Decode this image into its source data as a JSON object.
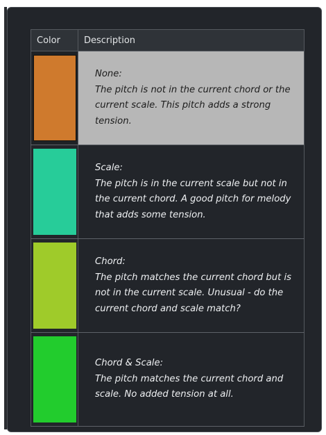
{
  "table": {
    "headers": {
      "color": "Color",
      "description": "Description"
    },
    "rows": [
      {
        "title": "None:",
        "text": "The pitch is not in the current chord or the current scale. This pitch adds a strong tension.",
        "color": "#cf7a2d",
        "selected": true
      },
      {
        "title": "Scale:",
        "text": "The pitch is in the current scale but not in the current chord. A good pitch for melody that adds some tension.",
        "color": "#27cc99",
        "selected": false
      },
      {
        "title": "Chord:",
        "text": "The pitch matches the current chord but is not in the current scale. Unusual - do the current chord and scale match?",
        "color": "#9fcb2a",
        "selected": false
      },
      {
        "title": "Chord & Scale:",
        "text": "The pitch matches the current chord and scale. No added tension at all.",
        "color": "#22cc2d",
        "selected": false
      }
    ]
  }
}
